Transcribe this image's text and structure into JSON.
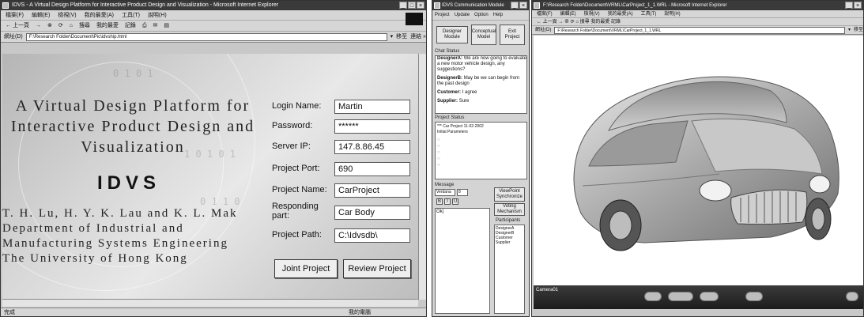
{
  "browser": {
    "title": "IDVS - A Virtual Design Platform for Interactive Product Design and Visualization - Microsoft Internet Explorer",
    "menu": [
      "檔案(F)",
      "編輯(E)",
      "檢視(V)",
      "我的最愛(A)",
      "工具(T)",
      "說明(H)"
    ],
    "toolbar": [
      "← 上一頁",
      "→",
      "⊗",
      "⟳",
      "⌂",
      "搜尋",
      "我的最愛",
      "記錄",
      "⎙",
      "✉",
      "▤"
    ],
    "address_label": "網址(D)",
    "address": "F:\\Research Folder\\Document\\Pic\\idvship.html",
    "go_label": "移至",
    "links_label": "連結 »",
    "status_left": "完成",
    "status_right": "我的電腦"
  },
  "page": {
    "heading_lines": [
      "A Virtual Design Platform for",
      "Interactive Product Design and",
      "Visualization"
    ],
    "logo_text": "IDVS",
    "author_lines": [
      "T. H. Lu, H. Y. K. Lau and K. L. Mak",
      "Department of Industrial and",
      "Manufacturing Systems Engineering",
      "The University of Hong Kong"
    ],
    "form": {
      "login_label": "Login Name:",
      "login_value": "Martin",
      "password_label": "Password:",
      "password_value": "******",
      "server_label": "Server IP:",
      "server_value": "147.8.86.45",
      "port_label": "Project Port:",
      "port_value": "690",
      "name_label": "Project Name:",
      "name_value": "CarProject",
      "part_label": "Responding part:",
      "part_value": "Car Body",
      "path_label": "Project Path:",
      "path_value": "C:\\Idvsdb\\",
      "join_button": "Joint Project",
      "review_button": "Review Project"
    }
  },
  "comm": {
    "title": "IDVS Communication Module",
    "menu": [
      "Project",
      "Update",
      "Option",
      "Help"
    ],
    "designer_button": "Designer Module",
    "conceptual_button": "Conceptual Model",
    "exit_button": "Exit Project",
    "chat_label": "Chat Status",
    "chat": [
      {
        "who": "DesignerA:",
        "msg": "We are now going to evaluate a new motor vehicle design, any suggestions?"
      },
      {
        "who": "DesignerB:",
        "msg": "May be we can begin from the past design"
      },
      {
        "who": "Customer:",
        "msg": "I agree"
      },
      {
        "who": "Supplier:",
        "msg": "Sure"
      }
    ],
    "project_label": "Project Status",
    "project_lines": [
      "*** Car Project 11-02-2002",
      "Initial Parameters"
    ],
    "message_label": "Message",
    "font_value": "Verdana",
    "size_value": "8",
    "format_buttons": [
      "B",
      "I",
      "U"
    ],
    "message_value": "Ok|",
    "viewpoint_button": "ViewPoint Synchronize",
    "voting_button": "Voting Mechanism",
    "participants_label": "Participants",
    "participants": [
      "DesignerA",
      "DesignerB",
      "Customer",
      "Supplier"
    ]
  },
  "vrml": {
    "title": "F:\\Research Folder\\Document\\VRML\\CarProject_1_1.WRL - Microsoft Internet Explorer",
    "menu": [
      "檔案(F)",
      "編輯(E)",
      "檢視(V)",
      "我的最愛(A)",
      "工具(T)",
      "說明(H)"
    ],
    "toolbar": "← 上一頁 → ⊗ ⟳ ⌂ 搜尋 我的最愛 記錄",
    "address_label": "網址(D)",
    "address": "F:\\Research Folder\\Document\\VRML\\CarProject_1_1.WRL",
    "go_label": "移至",
    "nav_label": "Camera01"
  }
}
